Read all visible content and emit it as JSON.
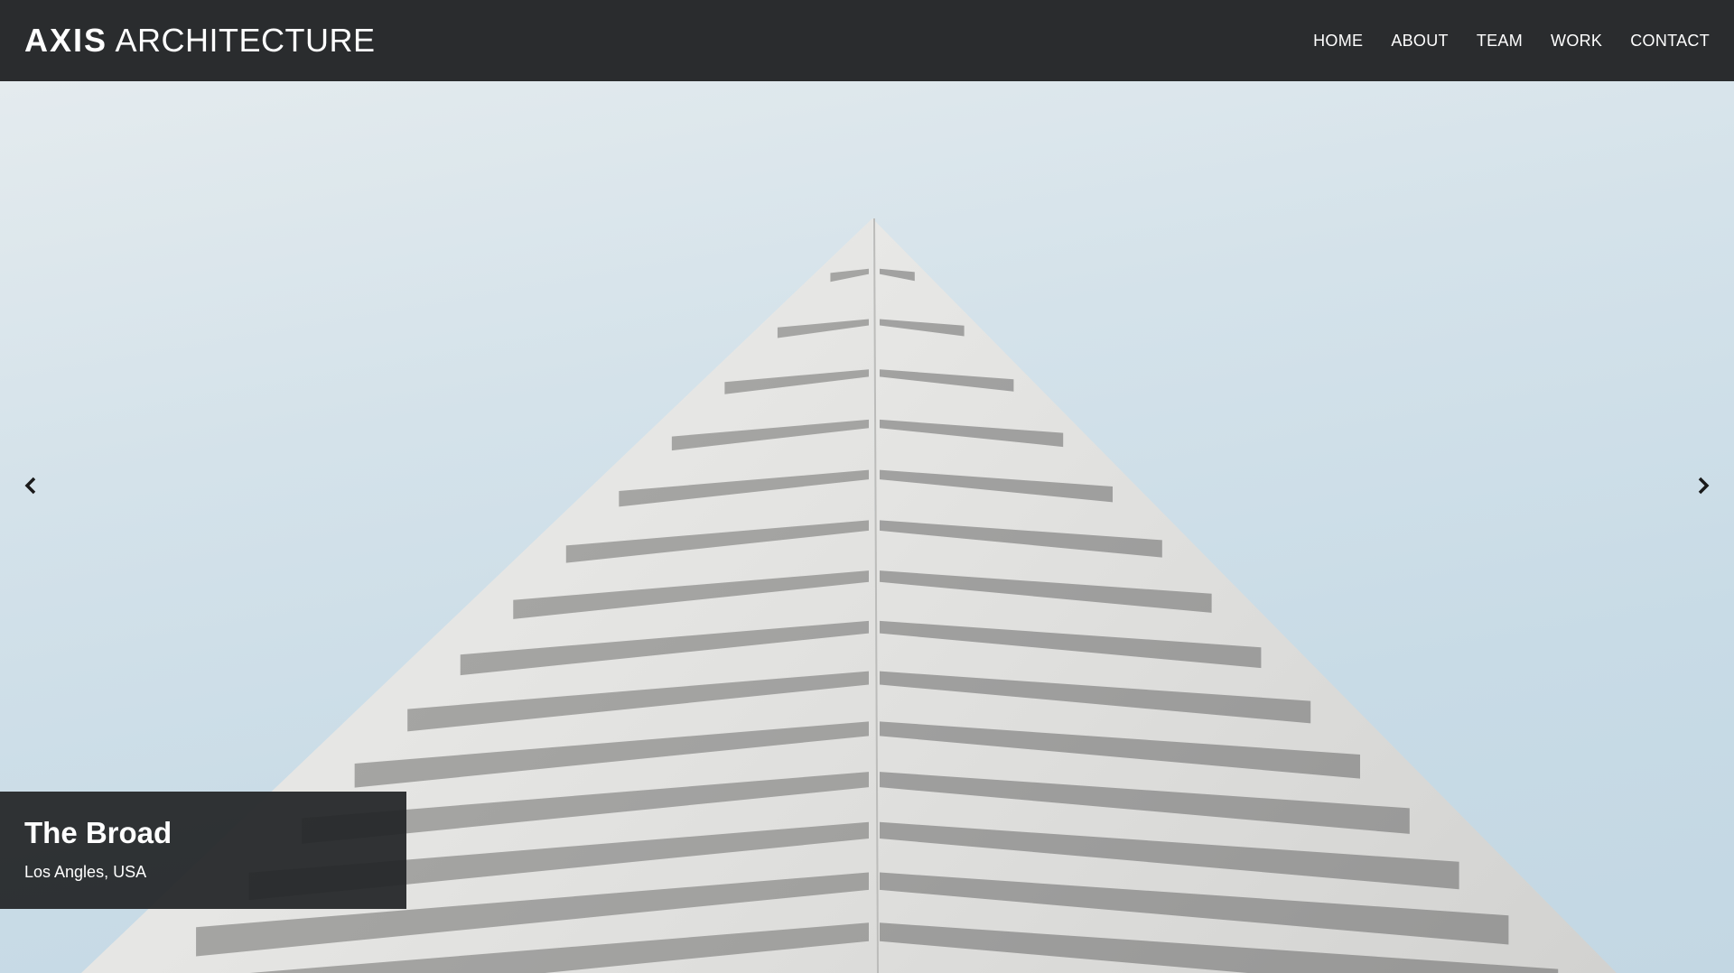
{
  "header": {
    "logo_bold": "AXIS",
    "logo_light": "ARCHITECTURE",
    "nav": [
      {
        "label": "HOME"
      },
      {
        "label": "ABOUT"
      },
      {
        "label": "TEAM"
      },
      {
        "label": "WORK"
      },
      {
        "label": "CONTACT"
      }
    ]
  },
  "slider": {
    "prev_icon": "chevron-left-icon",
    "next_icon": "chevron-right-icon",
    "caption": {
      "title": "The Broad",
      "subtitle": "Los Angles, USA"
    }
  },
  "colors": {
    "header_bg": "#2a2c2e",
    "sky": "#c8dbe6",
    "facade": "#e9e9e7"
  }
}
